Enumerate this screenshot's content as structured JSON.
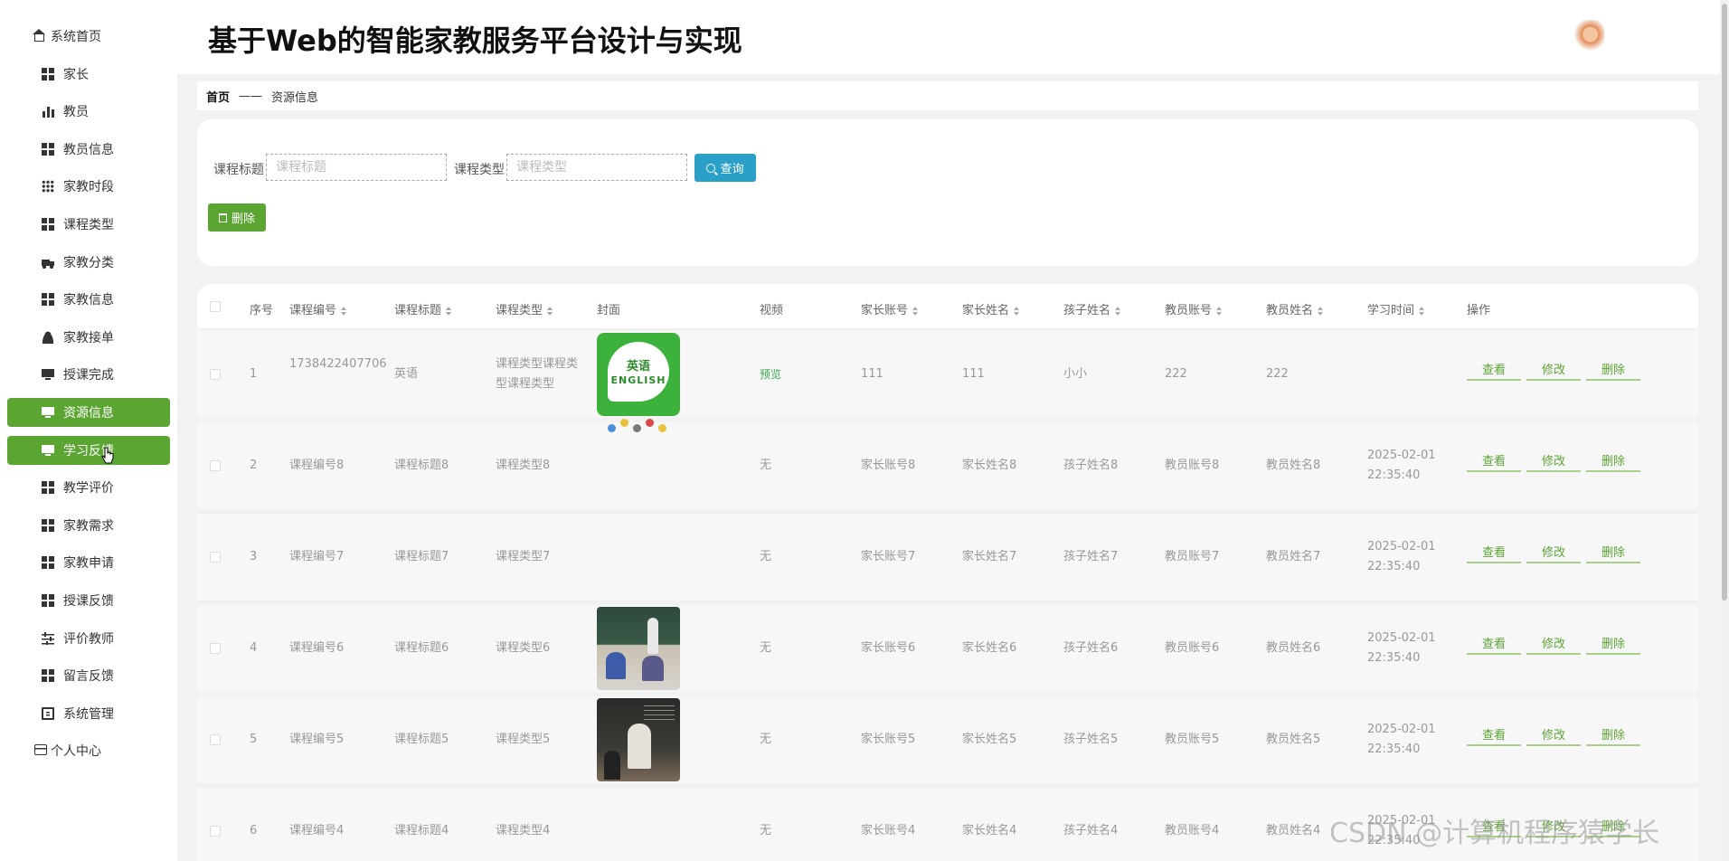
{
  "app": {
    "title": "基于Web的智能家教服务平台设计与实现"
  },
  "sidebar": {
    "items": [
      {
        "label": "系统首页",
        "icon": "home-icon"
      },
      {
        "label": "家长",
        "icon": "grid-icon"
      },
      {
        "label": "教员",
        "icon": "bar-chart-icon"
      },
      {
        "label": "教员信息",
        "icon": "grid-icon"
      },
      {
        "label": "家教时段",
        "icon": "dots-grid-icon"
      },
      {
        "label": "课程类型",
        "icon": "grid-icon"
      },
      {
        "label": "家教分类",
        "icon": "truck-icon"
      },
      {
        "label": "家教信息",
        "icon": "grid-icon"
      },
      {
        "label": "家教接单",
        "icon": "person-icon"
      },
      {
        "label": "授课完成",
        "icon": "monitor-icon"
      },
      {
        "label": "资源信息",
        "icon": "monitor-icon",
        "active": true
      },
      {
        "label": "学习反馈",
        "icon": "monitor-icon",
        "active": true
      },
      {
        "label": "教学评价",
        "icon": "grid-icon"
      },
      {
        "label": "家教需求",
        "icon": "grid-icon"
      },
      {
        "label": "家教申请",
        "icon": "grid-icon"
      },
      {
        "label": "授课反馈",
        "icon": "grid-icon"
      },
      {
        "label": "评价教师",
        "icon": "sliders-icon"
      },
      {
        "label": "留言反馈",
        "icon": "grid-icon"
      },
      {
        "label": "系统管理",
        "icon": "clipboard-icon"
      },
      {
        "label": "个人中心",
        "icon": "card-icon"
      }
    ]
  },
  "breadcrumb": {
    "home": "首页",
    "separator": "——",
    "current": "资源信息"
  },
  "search": {
    "title_label": "课程标题",
    "title_placeholder": "课程标题",
    "type_label": "课程类型",
    "type_placeholder": "课程类型",
    "search_button": "查询",
    "delete_button": "删除"
  },
  "table": {
    "headers": [
      "序号",
      "课程编号",
      "课程标题",
      "课程类型",
      "封面",
      "视频",
      "家长账号",
      "家长姓名",
      "孩子姓名",
      "教员账号",
      "教员姓名",
      "学习时间",
      "操作"
    ],
    "action_labels": [
      "查看",
      "修改",
      "删除"
    ],
    "rows": [
      {
        "index": "1",
        "code": "1738422407706",
        "title": "英语",
        "type": "课程类型课程类型课程类型",
        "cover": "english",
        "cover_text1": "英语",
        "cover_text2": "ENGLISH",
        "video": "预览",
        "parent_account": "111",
        "parent_name": "111",
        "child_name": "小小",
        "teacher_account": "222",
        "teacher_name": "222",
        "time": ""
      },
      {
        "index": "2",
        "code": "课程编号8",
        "title": "课程标题8",
        "type": "课程类型8",
        "cover": "doodle",
        "video": "无",
        "parent_account": "家长账号8",
        "parent_name": "家长姓名8",
        "child_name": "孩子姓名8",
        "teacher_account": "教员账号8",
        "teacher_name": "教员姓名8",
        "time": "2025-02-01 22:35:40"
      },
      {
        "index": "3",
        "code": "课程编号7",
        "title": "课程标题7",
        "type": "课程类型7",
        "cover": "none",
        "video": "无",
        "parent_account": "家长账号7",
        "parent_name": "家长姓名7",
        "child_name": "孩子姓名7",
        "teacher_account": "教员账号7",
        "teacher_name": "教员姓名7",
        "time": "2025-02-01 22:35:40"
      },
      {
        "index": "4",
        "code": "课程编号6",
        "title": "课程标题6",
        "type": "课程类型6",
        "cover": "classroom1",
        "video": "无",
        "parent_account": "家长账号6",
        "parent_name": "家长姓名6",
        "child_name": "孩子姓名6",
        "teacher_account": "教员账号6",
        "teacher_name": "教员姓名6",
        "time": "2025-02-01 22:35:40"
      },
      {
        "index": "5",
        "code": "课程编号5",
        "title": "课程标题5",
        "type": "课程类型5",
        "cover": "classroom2",
        "video": "无",
        "parent_account": "家长账号5",
        "parent_name": "家长姓名5",
        "child_name": "孩子姓名5",
        "teacher_account": "教员账号5",
        "teacher_name": "教员姓名5",
        "time": "2025-02-01 22:35:40"
      },
      {
        "index": "6",
        "code": "课程编号4",
        "title": "课程标题4",
        "type": "课程类型4",
        "cover": "none",
        "video": "无",
        "parent_account": "家长账号4",
        "parent_name": "家长姓名4",
        "child_name": "孩子姓名4",
        "teacher_account": "教员账号4",
        "teacher_name": "教员姓名4",
        "time": "2025-02-01 22:35:40"
      }
    ]
  },
  "watermark": "CSDN @计算机程序猿学长",
  "colors": {
    "accent": "#5ba533",
    "search_button": "#2aa0c8",
    "link": "#3daa4f"
  }
}
